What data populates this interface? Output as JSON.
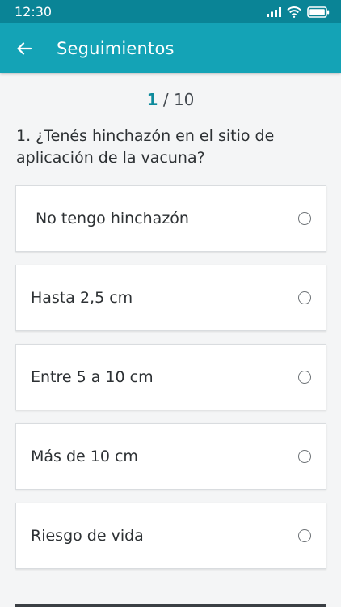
{
  "status_bar": {
    "time": "12:30"
  },
  "app_bar": {
    "title": "Seguimientos",
    "back_icon": "arrow-left-icon"
  },
  "progress": {
    "current": "1",
    "separator": " / ",
    "total": "10"
  },
  "question": {
    "text": "1. ¿Tenés hinchazón en el sitio de aplicación de la vacuna?"
  },
  "options": [
    {
      "label": " No tengo hinchazón"
    },
    {
      "label": "Hasta 2,5 cm"
    },
    {
      "label": "Entre 5 a 10 cm"
    },
    {
      "label": "Más de 10 cm"
    },
    {
      "label": "Riesgo de vida"
    }
  ],
  "colors": {
    "status_bar": "#0a8496",
    "app_bar": "#14a3b6",
    "accent": "#0d8a9c"
  }
}
